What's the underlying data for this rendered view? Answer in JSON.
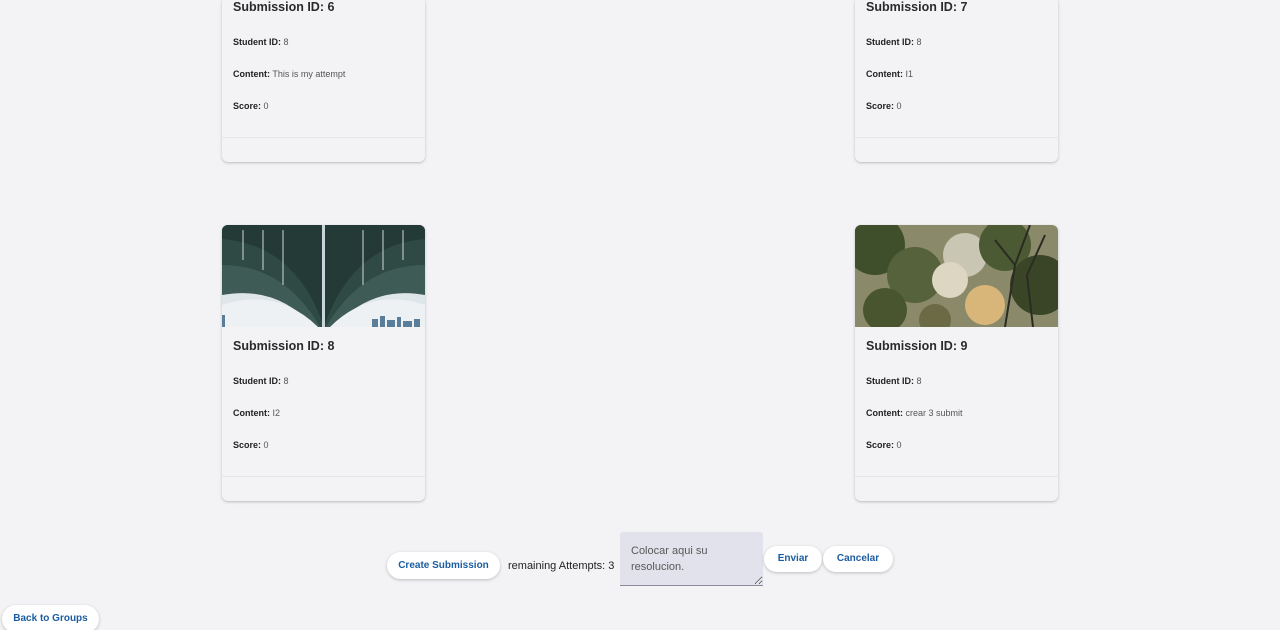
{
  "submissions": [
    {
      "title": "Submission ID: 6",
      "student_label": "Student ID:",
      "student": "8",
      "content_label": "Content:",
      "content": "This is my attempt",
      "score_label": "Score:",
      "score": "0",
      "image": ""
    },
    {
      "title": "Submission ID: 7",
      "student_label": "Student ID:",
      "student": "8",
      "content_label": "Content:",
      "content": "I1",
      "score_label": "Score:",
      "score": "0",
      "image": ""
    },
    {
      "title": "Submission ID: 8",
      "student_label": "Student ID:",
      "student": "8",
      "content_label": "Content:",
      "content": "I2",
      "score_label": "Score:",
      "score": "0",
      "image": "bridge-underside-photo"
    },
    {
      "title": "Submission ID: 9",
      "student_label": "Student ID:",
      "student": "8",
      "content_label": "Content:",
      "content": "crear 3 submit",
      "score_label": "Score:",
      "score": "0",
      "image": "tree-foliage-photo"
    }
  ],
  "actions": {
    "create_label": "Create Submission",
    "remaining_attempts": "remaining Attempts: 3",
    "answer_placeholder": "Colocar aqui su resolucion.",
    "send_label": "Enviar",
    "cancel_label": "Cancelar",
    "back_label": "Back to Groups"
  },
  "colors": {
    "background": "#f3f3f6",
    "button_text": "#1b5da0",
    "textarea_bg": "#e1e2ec"
  }
}
